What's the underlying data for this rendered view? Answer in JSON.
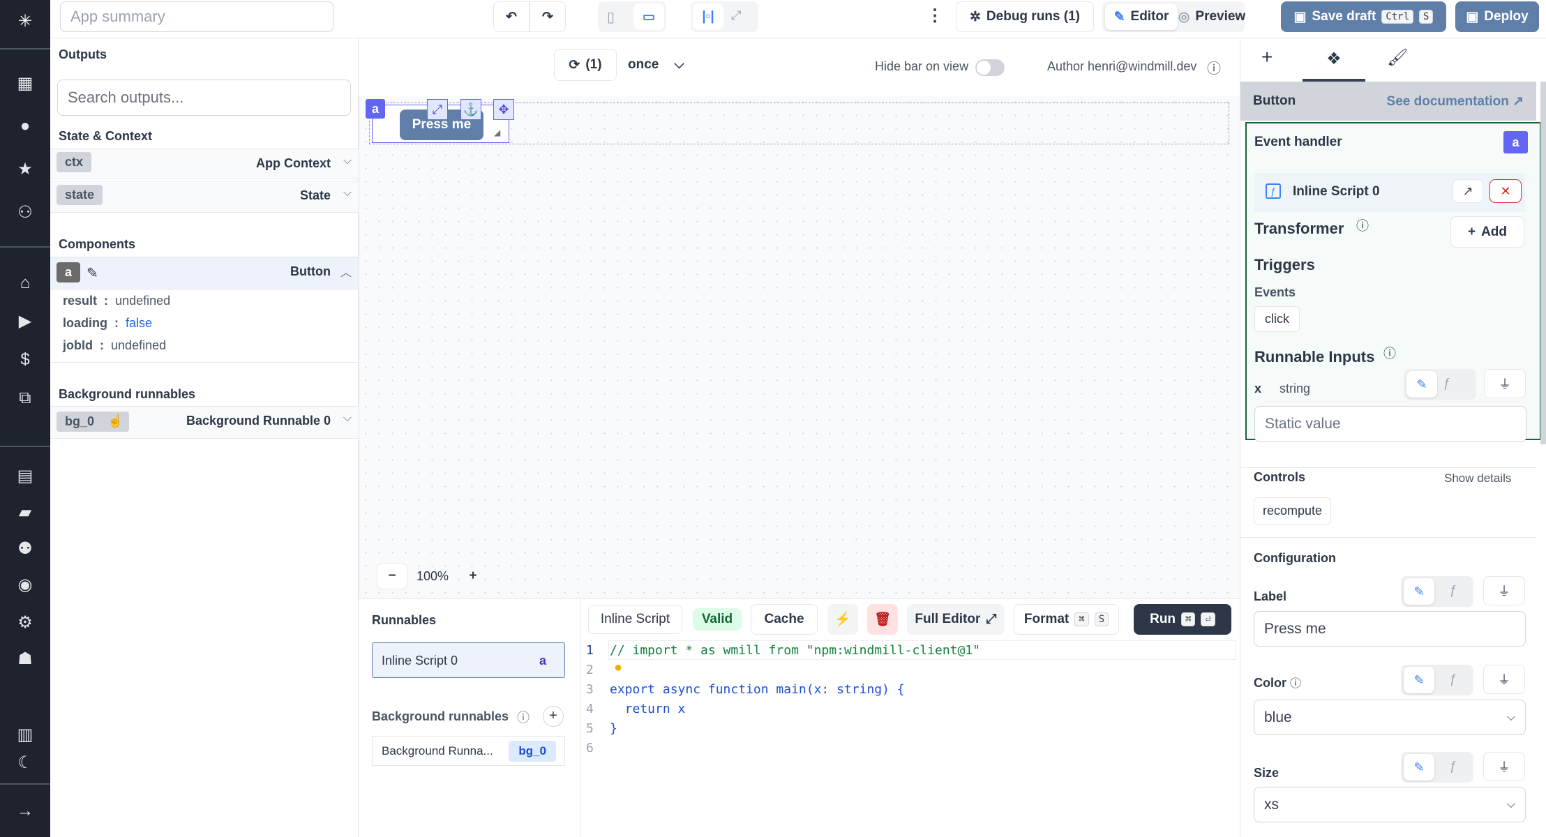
{
  "topbar": {
    "summary_placeholder": "App summary",
    "debug_runs": "Debug runs (1)",
    "editor": "Editor",
    "preview": "Preview",
    "save_draft": "Save draft",
    "save_kbd": [
      "Ctrl",
      "S"
    ],
    "deploy": "Deploy"
  },
  "left": {
    "outputs_title": "Outputs",
    "search_placeholder": "Search outputs...",
    "state_context": "State & Context",
    "ctx": {
      "tag": "ctx",
      "label": "App Context"
    },
    "state": {
      "tag": "state",
      "label": "State"
    },
    "components_title": "Components",
    "component": {
      "tag": "a",
      "label": "Button"
    },
    "fields": [
      {
        "key": "result",
        "value": "undefined"
      },
      {
        "key": "loading",
        "value": "false"
      },
      {
        "key": "jobId",
        "value": "undefined"
      }
    ],
    "bg_title": "Background runnables",
    "bg": {
      "tag": "bg_0",
      "label": "Background Runnable 0"
    }
  },
  "canvas": {
    "refresh": "(1)",
    "mode": "once",
    "hide_bar": "Hide bar on view",
    "hide_bar_on": false,
    "author": "Author henri@windmill.dev",
    "component_id": "a",
    "button_label": "Press me",
    "zoom": "100%"
  },
  "runnables": {
    "title": "Runnables",
    "items": [
      {
        "label": "Inline Script 0",
        "id": "a"
      }
    ],
    "bg_title": "Background runnables",
    "bg_items": [
      {
        "label": "Background Runna...",
        "id": "bg_0"
      }
    ]
  },
  "editor": {
    "script_name": "Inline Script",
    "valid": "Valid",
    "cache": "Cache",
    "full_editor": "Full Editor",
    "format": "Format",
    "format_kbd": [
      "⌘",
      "S"
    ],
    "run": "Run",
    "run_kbd": [
      "⌘",
      "⏎"
    ],
    "lines": [
      "// import * as wmill from \"npm:windmill-client@1\"",
      "",
      "export async function main(x: string) {",
      "  return x",
      "}",
      ""
    ]
  },
  "right": {
    "header": "Button",
    "doc_link": "See documentation",
    "event_handler": "Event handler",
    "badge": "a",
    "script": "Inline Script 0",
    "transformer": "Transformer",
    "add": "Add",
    "triggers": "Triggers",
    "events": "Events",
    "event": "click",
    "runnable_inputs": "Runnable Inputs",
    "input_name": "x",
    "input_type": "string",
    "static_placeholder": "Static value",
    "controls": "Controls",
    "show_details": "Show details",
    "recompute": "recompute",
    "configuration": "Configuration",
    "label_title": "Label",
    "label_value": "Press me",
    "color_title": "Color",
    "color_value": "blue",
    "size_title": "Size",
    "size_value": "xs"
  },
  "colors": {
    "sidebar": "#1e232e",
    "accent": "#6366f1",
    "primary": "#5f7fa8",
    "green_border": "#166534"
  }
}
